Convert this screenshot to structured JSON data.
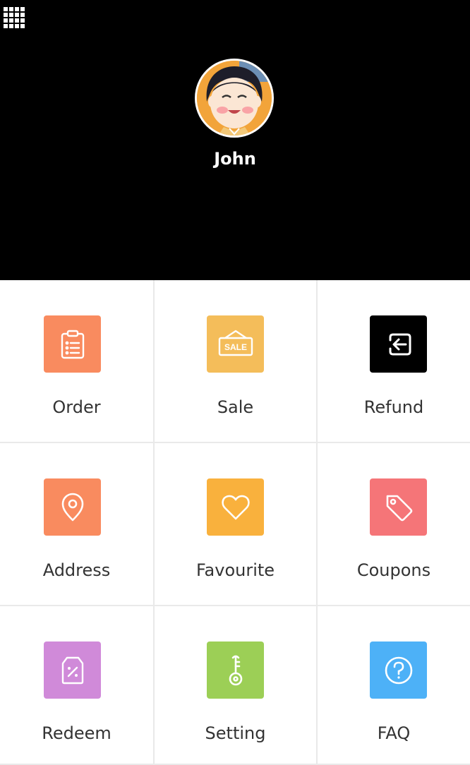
{
  "header": {
    "background": "#000000",
    "menu_icon": "grid-menu-icon",
    "user": {
      "name": "John",
      "avatar_icon": "cartoon-avatar"
    }
  },
  "menu": {
    "items": [
      {
        "label": "Order",
        "icon": "clipboard-list-icon",
        "color": "#f98b5f"
      },
      {
        "label": "Sale",
        "icon": "sale-sign-icon",
        "icon_text": "SALE",
        "color": "#f4bd5a"
      },
      {
        "label": "Refund",
        "icon": "refund-arrow-icon",
        "color": "#000000"
      },
      {
        "label": "Address",
        "icon": "location-pin-icon",
        "color": "#f98b5f"
      },
      {
        "label": "Favourite",
        "icon": "heart-icon",
        "color": "#f9b13d"
      },
      {
        "label": "Coupons",
        "icon": "price-tag-icon",
        "color": "#f57578"
      },
      {
        "label": "Redeem",
        "icon": "discount-tag-icon",
        "color": "#d08ad9"
      },
      {
        "label": "Setting",
        "icon": "key-icon",
        "color": "#9ccf56"
      },
      {
        "label": "FAQ",
        "icon": "question-circle-icon",
        "color": "#4db1f7"
      }
    ]
  }
}
